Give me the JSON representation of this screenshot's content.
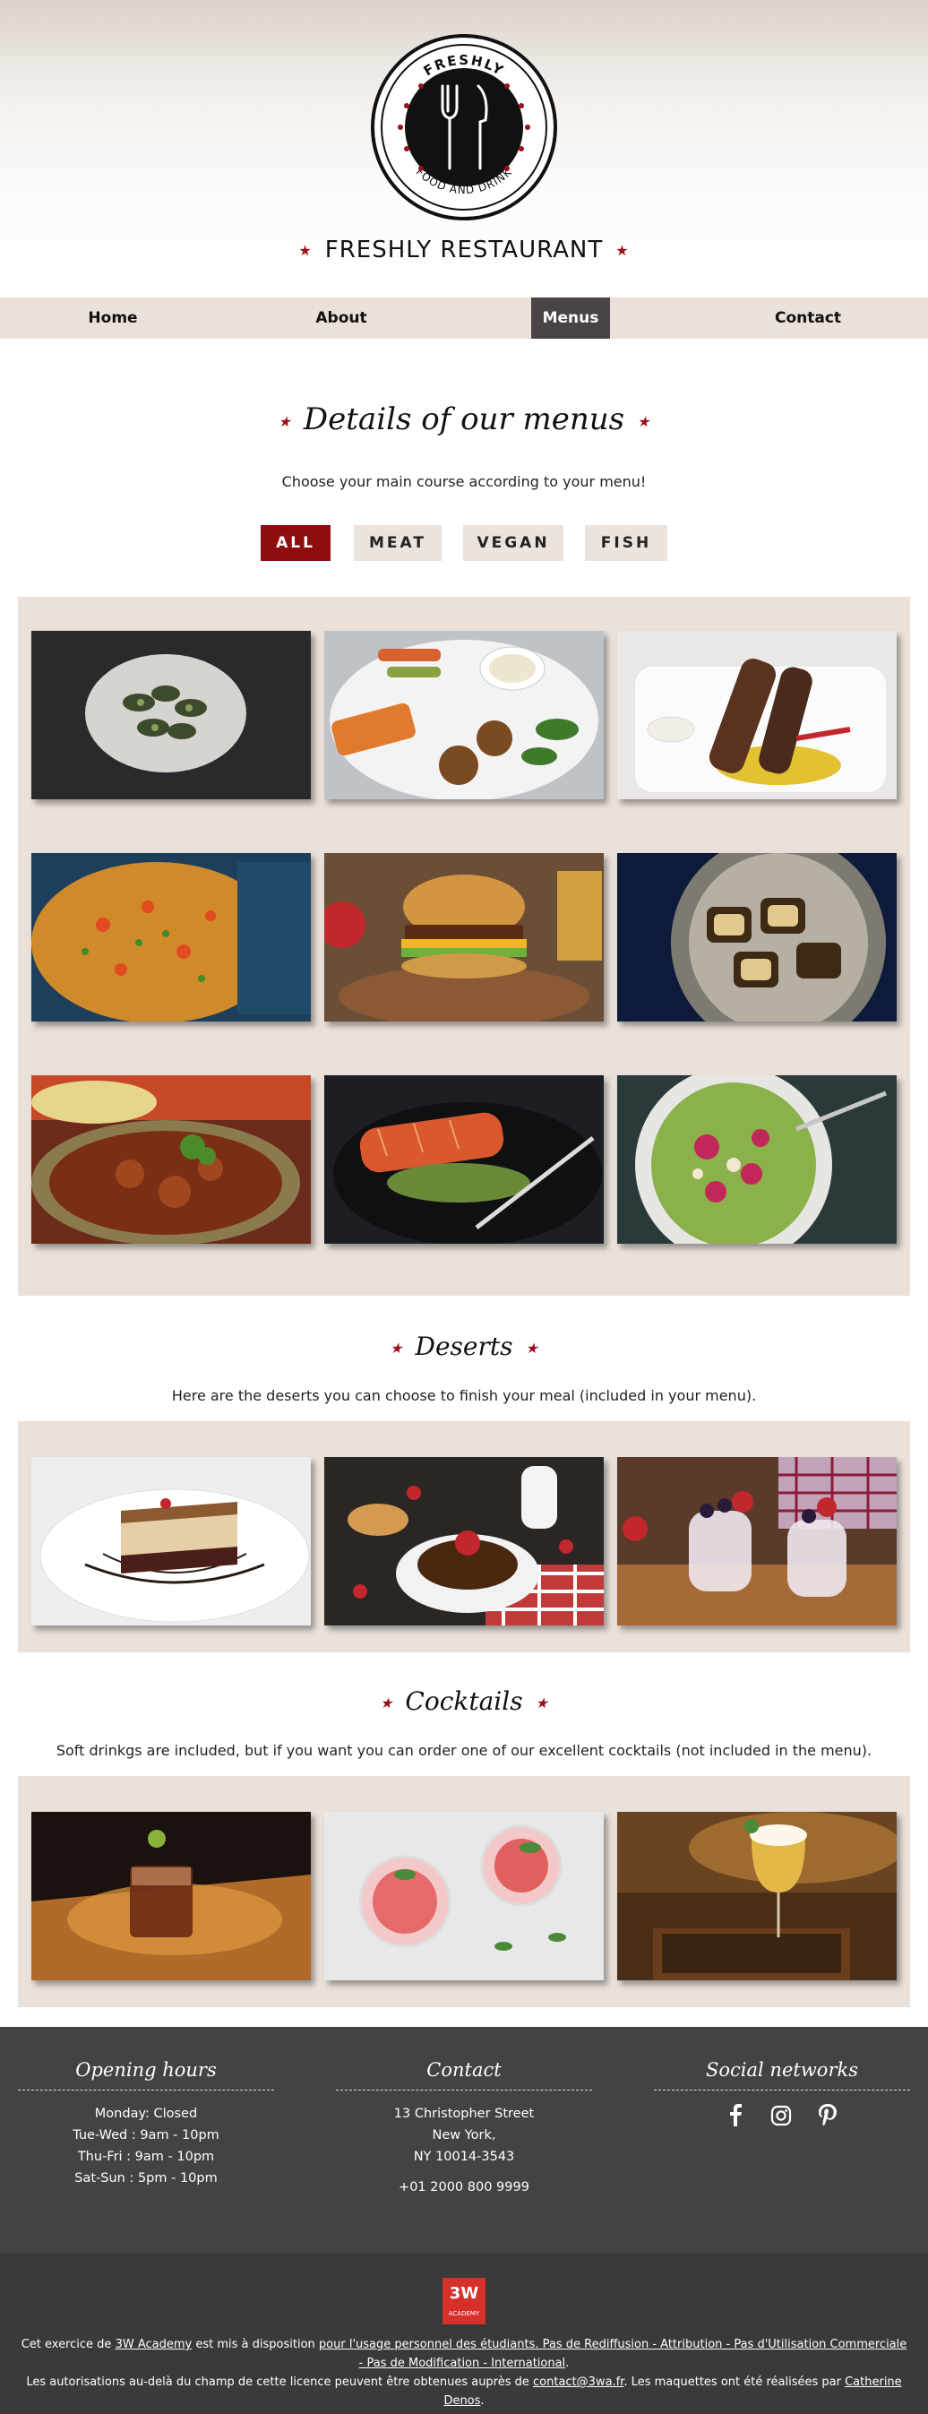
{
  "header": {
    "logo": {
      "top_text": "FRESHLY",
      "bottom_text": "FOOD AND DRINK"
    },
    "title": "FRESHLY RESTAURANT"
  },
  "nav": {
    "items": [
      "Home",
      "About",
      "Menus",
      "Contact"
    ],
    "active": "Menus"
  },
  "menus": {
    "heading": "Details of our menus",
    "intro": "Choose your main course according to your menu!",
    "filters": [
      "ALL",
      "MEAT",
      "VEGAN",
      "FISH"
    ],
    "active_filter": "ALL"
  },
  "deserts": {
    "heading": "Deserts",
    "intro": "Here are the deserts you can choose to finish your meal (included in your menu)."
  },
  "cocktails": {
    "heading": "Cocktails",
    "intro": "Soft drinkgs are included, but if you want you can order one of our excellent cocktails (not included in the menu)."
  },
  "footer": {
    "hours": {
      "heading": "Opening hours",
      "lines": [
        "Monday: Closed",
        "Tue-Wed : 9am - 10pm",
        "Thu-Fri : 9am - 10pm",
        "Sat-Sun : 5pm - 10pm"
      ]
    },
    "contact": {
      "heading": "Contact",
      "lines": [
        "13 Christopher Street",
        "New York,",
        "NY 10014-3543"
      ],
      "phone": "+01 2000 800 9999"
    },
    "social": {
      "heading": "Social networks",
      "icons": [
        "facebook-icon",
        "instagram-icon",
        "pinterest-icon"
      ]
    }
  },
  "credits": {
    "badge": "3W",
    "badge_sub": "ACADEMY",
    "line1_a": "Cet exercice de ",
    "line1_link1": "3W Academy",
    "line1_b": " est mis à disposition ",
    "line1_link2": "pour l'usage personnel des étudiants. Pas de Rediffusion - Attribution - Pas d'Utilisation Commerciale - Pas de Modification - International",
    "line1_c": ".",
    "line2_a": "Les autorisations au-delà du champ de cette licence peuvent être obtenues auprès de ",
    "line2_link1": "contact@3wa.fr",
    "line2_b": ". Les maquettes ont été réalisées par ",
    "line2_link2": "Catherine Denos",
    "line2_c": "."
  },
  "colors": {
    "accent": "#9b0f16",
    "nav_bg": "#e9e1da",
    "nav_active": "#4a4544",
    "footer_bg": "#454242",
    "credits_bg": "#3a3a3a"
  }
}
